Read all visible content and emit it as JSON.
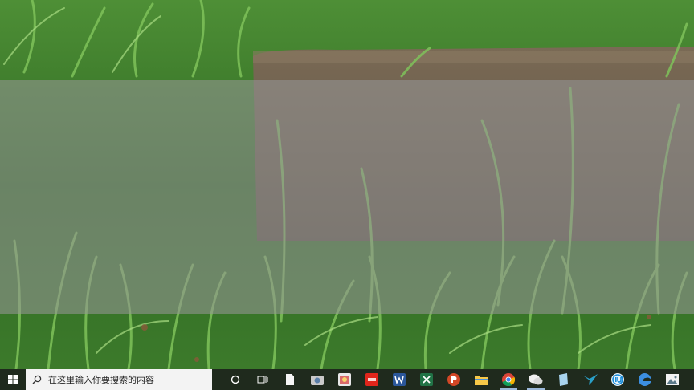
{
  "taskbar": {
    "search": {
      "placeholder": "在这里输入你要搜索的内容"
    },
    "icons": [
      "start-windows-icon",
      "search-magnifier-icon",
      "cortana-circle-icon",
      "task-view-icon",
      "file-icon",
      "camera-app-icon",
      "photo-app-icon",
      "red-app-icon",
      "word-icon",
      "excel-icon",
      "powerpoint-icon",
      "file-explorer-icon",
      "chrome-icon",
      "wechat-icon",
      "notes-app-icon",
      "bird-app-icon",
      "iu-app-icon",
      "edge-icon",
      "photos-icon"
    ]
  },
  "colors": {
    "taskbar_bg": "#1f2a1d",
    "search_bg": "#f3f3f3",
    "overlay": "rgba(150,150,150,0.58)",
    "grass": "#3f7f2c",
    "stone": "#6b5c49"
  }
}
